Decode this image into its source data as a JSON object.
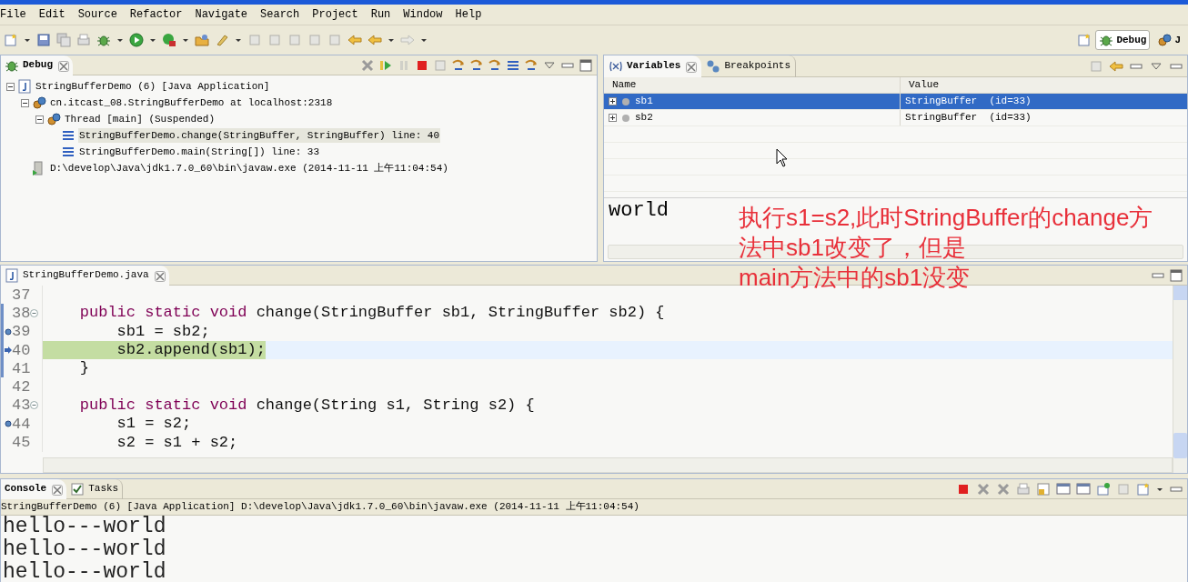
{
  "menu": [
    "File",
    "Edit",
    "Source",
    "Refactor",
    "Navigate",
    "Search",
    "Project",
    "Run",
    "Window",
    "Help"
  ],
  "perspectives": [
    {
      "label": "Debug",
      "selected": true
    },
    {
      "label": "J",
      "selected": false
    }
  ],
  "debug_view": {
    "tab": "Debug",
    "tree": [
      {
        "kind": "launch",
        "label": "StringBufferDemo (6) [Java Application]",
        "expanded": true,
        "selected": false,
        "children": [
          {
            "kind": "target",
            "label": "cn.itcast_08.StringBufferDemo at localhost:2318",
            "expanded": true,
            "selected": false,
            "children": [
              {
                "kind": "thread",
                "label": "Thread [main] (Suspended)",
                "expanded": true,
                "selected": false,
                "children": [
                  {
                    "kind": "frame",
                    "label": "StringBufferDemo.change(StringBuffer, StringBuffer) line: 40",
                    "selected": true
                  },
                  {
                    "kind": "frame",
                    "label": "StringBufferDemo.main(String[]) line: 33",
                    "selected": false
                  }
                ]
              }
            ]
          },
          {
            "kind": "process",
            "label": "D:\\develop\\Java\\jdk1.7.0_60\\bin\\javaw.exe (2014-11-11 上午11:04:54)",
            "selected": false
          }
        ]
      }
    ]
  },
  "variables_view": {
    "tabs": [
      {
        "label": "Variables",
        "selected": true
      },
      {
        "label": "Breakpoints",
        "selected": false
      }
    ],
    "columns": [
      "Name",
      "Value"
    ],
    "rows": [
      {
        "name": "sb1",
        "value": "StringBuffer  (id=33)",
        "selected": true
      },
      {
        "name": "sb2",
        "value": "StringBuffer  (id=33)",
        "selected": false
      }
    ],
    "detail": "world"
  },
  "annotation": [
    "执行s1=s2,此时StringBuffer的change方",
    "法中sb1改变了，但是",
    "main方法中的sb1没变"
  ],
  "editor": {
    "tab": "StringBufferDemo.java",
    "lines": [
      {
        "number": "37",
        "breakpoint": false,
        "instruction": false,
        "fold": false,
        "in_range": false,
        "current": false
      },
      {
        "number": "38",
        "breakpoint": false,
        "instruction": false,
        "fold": true,
        "in_range": true,
        "current": false,
        "segments": [
          {
            "kind": "keyword",
            "text": "    public static void"
          },
          {
            "kind": "plain",
            "text": " change(StringBuffer sb1, StringBuffer sb2) {"
          }
        ]
      },
      {
        "number": "39",
        "breakpoint": true,
        "instruction": false,
        "fold": false,
        "in_range": true,
        "current": false,
        "segments": [
          {
            "kind": "plain",
            "text": "        sb1 = sb2;"
          }
        ]
      },
      {
        "number": "40",
        "breakpoint": false,
        "instruction": true,
        "fold": false,
        "in_range": true,
        "current": true,
        "segments": [
          {
            "kind": "plain",
            "text": "        sb2.append(sb1);"
          }
        ]
      },
      {
        "number": "41",
        "breakpoint": false,
        "instruction": false,
        "fold": false,
        "in_range": true,
        "current": false,
        "segments": [
          {
            "kind": "plain",
            "text": "    }"
          }
        ]
      },
      {
        "number": "42",
        "breakpoint": false,
        "instruction": false,
        "fold": false,
        "in_range": false,
        "current": false
      },
      {
        "number": "43",
        "breakpoint": false,
        "instruction": false,
        "fold": true,
        "in_range": false,
        "current": false,
        "segments": [
          {
            "kind": "keyword",
            "text": "    public static void"
          },
          {
            "kind": "plain",
            "text": " change(String s1, String s2) {"
          }
        ]
      },
      {
        "number": "44",
        "breakpoint": true,
        "instruction": false,
        "fold": false,
        "in_range": false,
        "current": false,
        "segments": [
          {
            "kind": "plain",
            "text": "        s1 = s2;"
          }
        ]
      },
      {
        "number": "45",
        "breakpoint": false,
        "instruction": false,
        "fold": false,
        "in_range": false,
        "current": false,
        "segments": [
          {
            "kind": "plain",
            "text": "        s2 = s1 + s2;"
          }
        ]
      }
    ]
  },
  "console": {
    "tabs": [
      {
        "label": "Console",
        "selected": true
      },
      {
        "label": "Tasks",
        "selected": false
      }
    ],
    "process": "StringBufferDemo (6) [Java Application] D:\\develop\\Java\\jdk1.7.0_60\\bin\\javaw.exe (2014-11-11 上午11:04:54)",
    "output": [
      "hello---world",
      "hello---world",
      "hello---world"
    ]
  }
}
